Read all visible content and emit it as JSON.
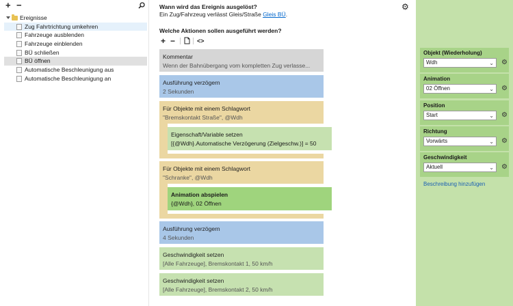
{
  "left_toolbar": {
    "add": "+",
    "remove": "−",
    "search_icon": "search-icon"
  },
  "tree": {
    "root_label": "Ereignisse",
    "items": [
      "Zug Fahrtrichtung umkehren",
      "Fahrzeuge ausblenden",
      "Fahrzeuge einblenden",
      "BÜ schließen",
      "BÜ öffnen",
      "Automatische Beschleunigung aus",
      "Automatische Beschleunigung an"
    ]
  },
  "main": {
    "question_trigger": "Wann wird das Ereignis ausgelöst?",
    "trigger_text": "Ein Zug/Fahrzeug verlässt Gleis/Straße",
    "trigger_link": "Gleis BÜ",
    "trigger_suffix": ".",
    "question_actions": "Welche Aktionen sollen ausgeführt werden?",
    "toolbar": {
      "add": "+",
      "remove": "−",
      "copy_icon": "copy-icon",
      "code": "<>"
    },
    "blocks": {
      "comment_head": "Kommentar",
      "comment_sub": "Wenn der Bahnübergang vom kompletten Zug verlasse...",
      "delay1_head": "Ausführung verzögern",
      "delay1_sub": "2 Sekunden",
      "forall1_head": "Für Objekte mit einem Schlagwort",
      "forall1_sub": "\"Bremskontakt Straße\", @Wdh",
      "setvar_head": "Eigenschaft/Variable setzen",
      "setvar_sub": "[{@Wdh}.Automatische Verzögerung (Zielgeschw.)] = 50",
      "forall2_head": "Für Objekte mit einem Schlagwort",
      "forall2_sub": "\"Schranke\", @Wdh",
      "anim_head": "Animation abspielen",
      "anim_sub": "{@Wdh}, 02 Öffnen",
      "delay2_head": "Ausführung verzögern",
      "delay2_sub": "4 Sekunden",
      "speed1_head": "Geschwindigkeit setzen",
      "speed1_sub": "[Alle Fahrzeuge], Bremskontakt 1, 50 km/h",
      "speed2_head": "Geschwindigkeit setzen",
      "speed2_sub": "[Alle Fahrzeuge], Bremskontakt 2, 50 km/h"
    }
  },
  "properties": {
    "object_label": "Objekt (Wiederholung)",
    "object_value": "Wdh",
    "animation_label": "Animation",
    "animation_value": "02 Öffnen",
    "position_label": "Position",
    "position_value": "Start",
    "direction_label": "Richtung",
    "direction_value": "Vorwärts",
    "speed_label": "Geschwindigkeit",
    "speed_value": "Aktuell",
    "add_description": "Beschreibung hinzufügen"
  },
  "colors": {
    "comment": "#d6d6d6",
    "delay": "#a9c7e8",
    "loop": "#ebd7a2",
    "setvar": "#c6e1b0",
    "animation": "#9fd47d",
    "properties_bg": "#c4e1aa"
  }
}
